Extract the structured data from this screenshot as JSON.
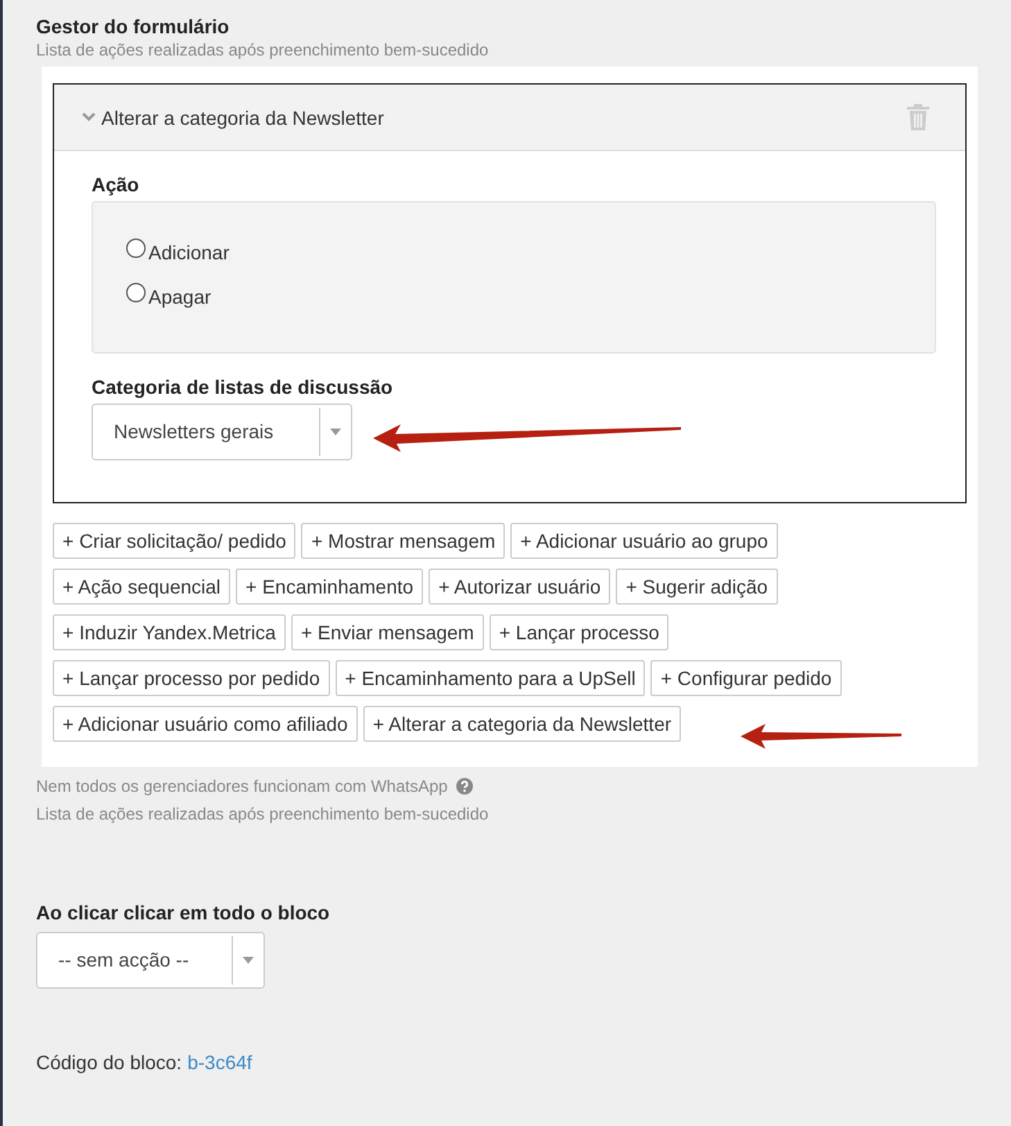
{
  "section": {
    "title": "Gestor do formulário",
    "subtitle": "Lista de ações realizadas após preenchimento bem-sucedido"
  },
  "handler": {
    "title": "Alterar a categoria da Newsletter",
    "expanded": true,
    "action_label": "Ação",
    "options": [
      {
        "label": "Adicionar",
        "selected": false
      },
      {
        "label": "Apagar",
        "selected": false
      }
    ],
    "category_label": "Categoria de listas de discussão",
    "category_value": "Newsletters gerais"
  },
  "add_buttons": [
    [
      "+ Criar solicitação/ pedido",
      "+ Mostrar mensagem",
      "+ Adicionar usuário ao grupo"
    ],
    [
      "+ Ação sequencial",
      "+ Encaminhamento",
      "+ Autorizar usuário",
      "+ Sugerir adição"
    ],
    [
      "+ Induzir Yandex.Metrica",
      "+ Enviar mensagem",
      "+ Lançar processo"
    ],
    [
      "+ Lançar processo por pedido",
      "+ Encaminhamento para a UpSell",
      "+ Configurar pedido"
    ],
    [
      "+ Adicionar usuário como afiliado",
      "+ Alterar a categoria da Newsletter"
    ]
  ],
  "notes": [
    "Nem todos os gerenciadores funcionam com WhatsApp",
    "Lista de ações realizadas após preenchimento bem-sucedido"
  ],
  "click_action": {
    "label": "Ao clicar clicar em todo o bloco",
    "value": "-- sem acção --"
  },
  "block_code": {
    "label": "Código do bloco:",
    "value": "b-3c64f"
  }
}
